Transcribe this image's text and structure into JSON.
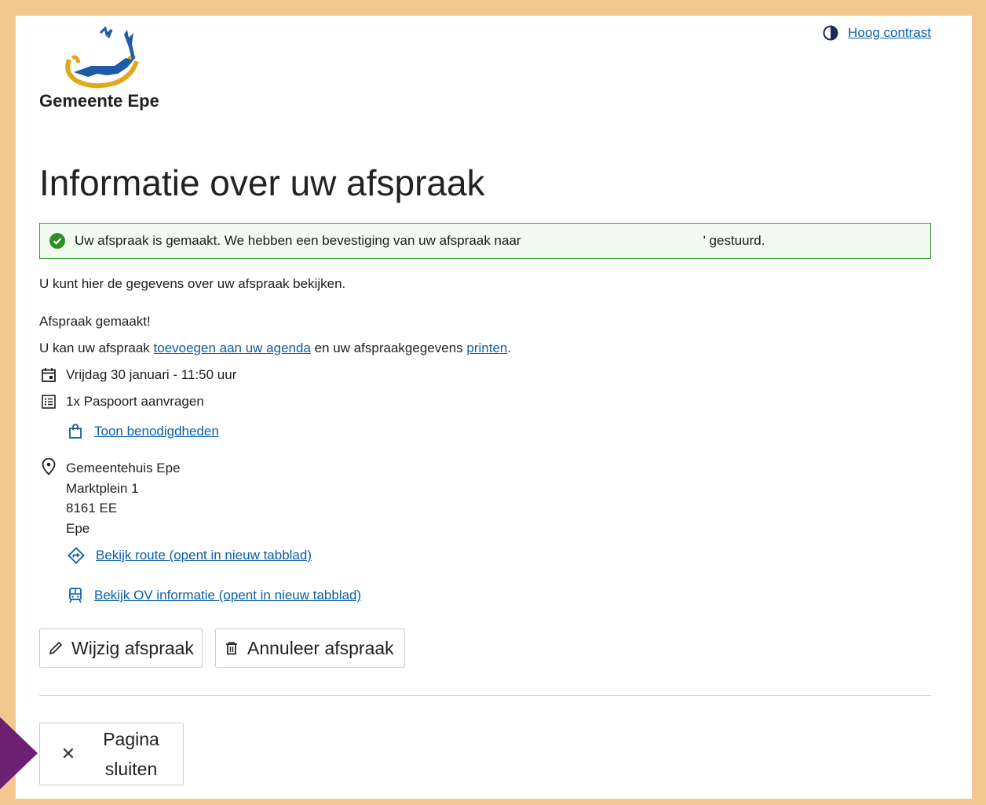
{
  "header": {
    "brand": "Gemeente Epe",
    "contrast_link": "Hoog contrast"
  },
  "page": {
    "title": "Informatie over uw afspraak"
  },
  "alert": {
    "text_before": "Uw afspraak is gemaakt. We hebben een bevestiging van uw afspraak naar",
    "text_after": "' gestuurd."
  },
  "intro": "U kunt hier de gegevens over uw afspraak bekijken.",
  "made": {
    "heading": "Afspraak gemaakt!",
    "prefix": "U kan uw afspraak ",
    "agenda_link": "toevoegen aan uw agenda",
    "middle": " en uw afspraakgegevens ",
    "print_link": "printen",
    "suffix": "."
  },
  "appointment": {
    "datetime": "Vrijdag 30 januari - 11:50 uur",
    "product": "1x Paspoort aanvragen",
    "requirements_link": "Toon benodigdheden",
    "location": {
      "name": "Gemeentehuis Epe",
      "street": "Marktplein 1",
      "postcode": "8161 EE",
      "city": "Epe"
    },
    "route_link": "Bekijk route (opent in nieuw tabblad)",
    "ov_link": "Bekijk OV informatie (opent in nieuw tabblad)"
  },
  "actions": {
    "edit": "Wijzig afspraak",
    "cancel": "Annuleer afspraak",
    "close_line1": "Pagina",
    "close_line2": "sluiten"
  },
  "colors": {
    "outer_frame": "#f3c78f",
    "link": "#0b5ea8",
    "success_border": "#3f9b3a",
    "success_bg": "#f1fbef",
    "marker": "#6b2072"
  }
}
